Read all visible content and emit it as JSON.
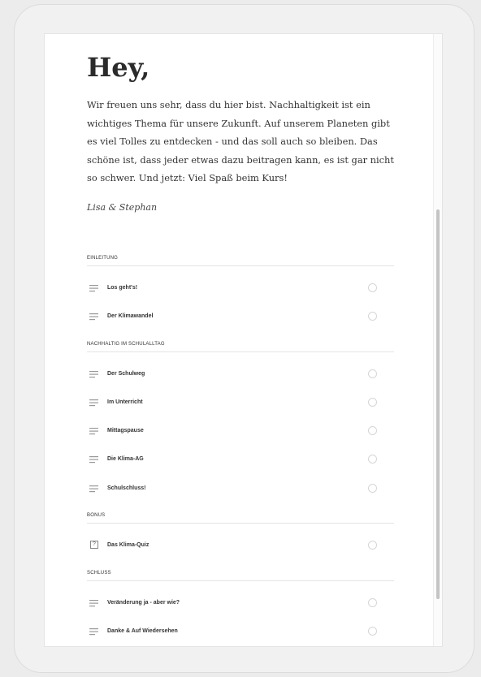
{
  "page": {
    "title": "Hey,",
    "intro": "Wir freuen uns sehr, dass du hier bist. Nachhaltigkeit ist ein wichtiges Thema für unsere Zukunft. Auf unserem Planeten gibt es viel Tolles zu entdecken - und das soll auch so bleiben. Das schöne ist, dass jeder etwas dazu beitragen kann, es ist gar nicht so schwer. Und jetzt: Viel Spaß beim Kurs!",
    "signature": "Lisa & Stephan"
  },
  "sections": [
    {
      "header": "EINLEITUNG",
      "lessons": [
        {
          "label": "Los geht's!",
          "icon": "text-lines-icon"
        },
        {
          "label": "Der Klimawandel",
          "icon": "text-lines-icon"
        }
      ]
    },
    {
      "header": "NACHHALTIG IM SCHULALLTAG",
      "lessons": [
        {
          "label": "Der Schulweg",
          "icon": "text-lines-icon"
        },
        {
          "label": "Im Unterricht",
          "icon": "text-lines-icon"
        },
        {
          "label": "Mittagspause",
          "icon": "text-lines-icon"
        },
        {
          "label": "Die Klima-AG",
          "icon": "text-lines-icon"
        },
        {
          "label": "Schulschluss!",
          "icon": "text-lines-icon"
        }
      ]
    },
    {
      "header": "BONUS",
      "lessons": [
        {
          "label": "Das Klima-Quiz",
          "icon": "quiz-icon",
          "icon_glyph": "?"
        }
      ]
    },
    {
      "header": "SCHLUSS",
      "lessons": [
        {
          "label": "Veränderung ja - aber wie?",
          "icon": "text-lines-icon"
        },
        {
          "label": "Danke & Auf Wiedersehen",
          "icon": "text-lines-icon"
        }
      ]
    }
  ],
  "colors": {
    "text": "#333333",
    "divider": "#e3e3e3",
    "radio_border": "#d6d6d6",
    "scrollbar": "#c4c4c4"
  }
}
